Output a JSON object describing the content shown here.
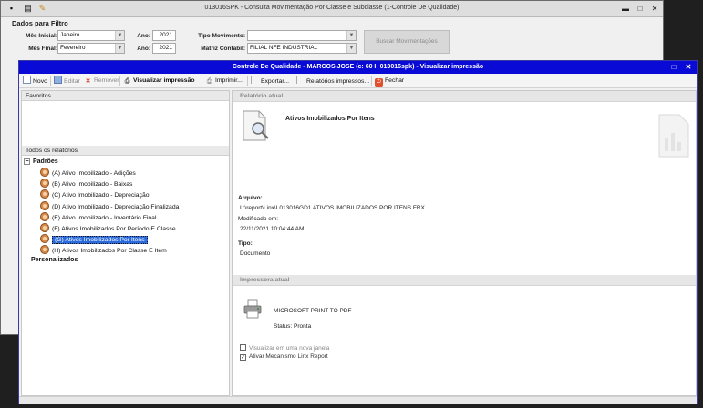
{
  "background_window": {
    "title": "013016SPK - Consulta Movimentação Por Classe e Subclasse (1-Controle De Qualidade)",
    "section_title": "Dados para Filtro",
    "fields": {
      "mes_inicial_label": "Mês Inicial:",
      "mes_inicial_value": "Janeiro",
      "ano1_label": "Ano:",
      "ano1_value": "2021",
      "tipo_movimento_label": "Tipo Movimento:",
      "tipo_movimento_value": "",
      "mes_final_label": "Mês Final:",
      "mes_final_value": "Fevereiro",
      "ano2_label": "Ano:",
      "ano2_value": "2021",
      "matriz_label": "Matriz Contabil:",
      "matriz_value": "FILIAL NFE INDUSTRIAL"
    },
    "search_button": "Buscar Movimentações",
    "controls": {
      "minimize": "▬",
      "maximize": "□",
      "close": "✕"
    }
  },
  "foreground_window": {
    "title": "Controle De Qualidade - MARCOS.JOSE (c: 60 I: 013016spk) - Visualizar impressão",
    "controls": {
      "restore": "□",
      "close": "✕"
    },
    "toolbar": {
      "novo": "Novo",
      "editar": "Editar",
      "remover": "Remover",
      "visualizar": "Visualizar impressão",
      "imprimir": "Imprimir...",
      "exportar": "Exportar...",
      "relatorios": "Relatórios impressos...",
      "fechar": "Fechar"
    },
    "left": {
      "favoritos": "Favoritos",
      "todos": "Todos os relatórios",
      "padroes": "Padrões",
      "reports": [
        "(A) Ativo Imobilizado - Adições",
        "(B) Ativo Imobilizado - Baixas",
        "(C) Ativo Imobilizado - Depreciação",
        "(D) Ativo Imobilizado - Depreciação Finalizada",
        "(E) Ativo Imobilizado - Inventário Final",
        "(F) Ativos Imobilizados Por Período E Classe",
        "(G) Ativos Imobilizados Por Itens",
        "(H) Ativos Imobilizados Por Classe E Item"
      ],
      "selected_index": 6,
      "personalizados": "Personalizados"
    },
    "right": {
      "relatorio_atual": "Relatório atual",
      "report_name": "Ativos Imobilizados Por Itens",
      "arquivo_label": "Arquivo:",
      "arquivo_value": "L:\\report\\Linx\\L013016GD1 ATIVOS IMOBILIZADOS POR ITENS.FRX",
      "modificado_label": "Modificado em:",
      "modificado_value": "22/11/2021 10:04:44 AM",
      "tipo_label": "Tipo:",
      "tipo_value": "Documento",
      "impressora_atual": "Impressora atual",
      "printer_name": "MICROSOFT PRINT TO PDF",
      "status": "Status:  Pronta",
      "chk_nova_janela": "Visualizar em uma nova janela",
      "chk_nova_janela_checked": false,
      "chk_linx": "Ativar Mecanismo Linx Report",
      "chk_linx_checked": true
    }
  }
}
